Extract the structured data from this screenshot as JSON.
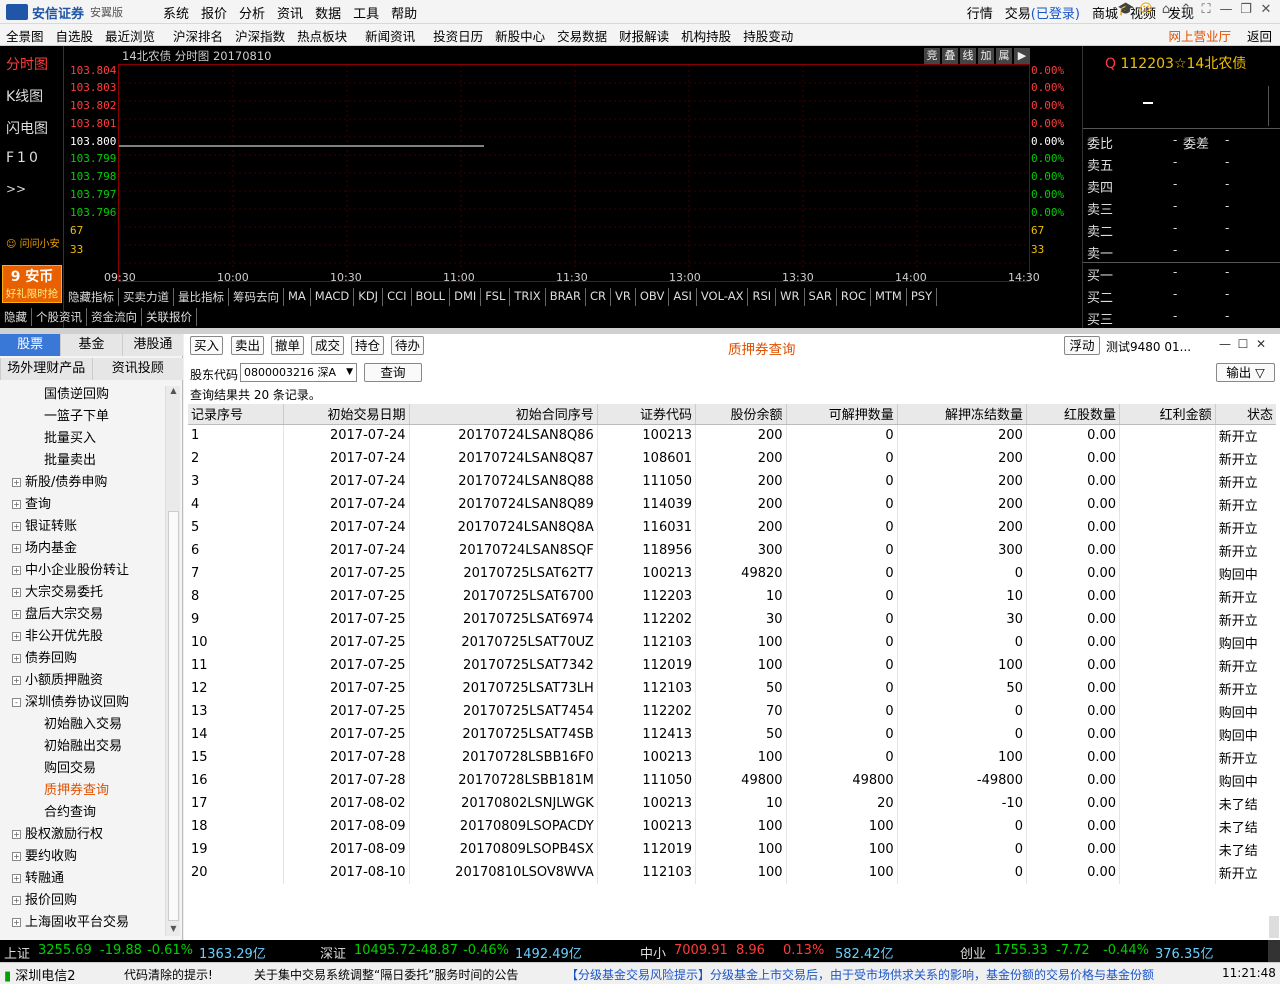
{
  "app": {
    "logo_name": "安信证券",
    "logo_en": "ESSENCE SECURITIES",
    "edition": "安翼版"
  },
  "menu": [
    "系统",
    "报价",
    "分析",
    "资讯",
    "数据",
    "工具",
    "帮助"
  ],
  "right_menu": {
    "quote": "行情",
    "trade": "交易",
    "trade_status": "(已登录)",
    "mall": "商城",
    "video": "视频",
    "discover": "发现"
  },
  "nav": [
    "全景图",
    "自选股",
    "最近浏览",
    "沪深排名",
    "沪深指数",
    "热点板块",
    "新闻资讯",
    "投资日历",
    "新股中心",
    "交易数据",
    "财报解读",
    "机构持股",
    "持股变动"
  ],
  "nav_right": {
    "online": "网上营业厅",
    "back": "返回"
  },
  "chart": {
    "title": "14北农债 分时图 20170810",
    "left_tabs": [
      "分时图",
      "K线图",
      "闪电图",
      "F10",
      ">>"
    ],
    "ask_label": "问问小安",
    "promo_title": "9 安币",
    "promo_sub": "好礼限时抢",
    "tools": [
      "竞",
      "叠",
      "线",
      "加",
      "属",
      "▶"
    ],
    "y_labels": [
      "103.804",
      "103.803",
      "103.802",
      "103.801",
      "103.800",
      "103.799",
      "103.798",
      "103.797",
      "103.796",
      "67",
      "33"
    ],
    "pct_labels": [
      "0.00%",
      "0.00%",
      "0.00%",
      "0.00%",
      "0.00%",
      "0.00%",
      "0.00%",
      "0.00%",
      "0.00%",
      "67",
      "33"
    ],
    "x_labels": [
      "09:30",
      "10:00",
      "10:30",
      "11:00",
      "11:30",
      "13:00",
      "13:30",
      "14:00",
      "14:30",
      "15:00"
    ],
    "indicators": [
      "隐藏指标",
      "买卖力道",
      "量比指标",
      "筹码去向",
      "MA",
      "MACD",
      "KDJ",
      "CCI",
      "BOLL",
      "DMI",
      "FSL",
      "TRIX",
      "BRAR",
      "CR",
      "VR",
      "OBV",
      "ASI",
      "VOL-AX",
      "RSI",
      "WR",
      "SAR",
      "ROC",
      "MTM",
      "PSY"
    ],
    "bottom_tabs": [
      "隐藏",
      "个股资讯",
      "资金流向",
      "关联报价"
    ]
  },
  "chart_data": {
    "type": "line",
    "series": [
      {
        "values": [
          103.8,
          103.8
        ]
      }
    ],
    "x": [
      "09:30",
      "11:00"
    ],
    "ylim": [
      103.796,
      103.804
    ]
  },
  "quote": {
    "code": "112203",
    "star": "☆",
    "name": "14北农债",
    "prefix": "Q",
    "ratio_label": "委比",
    "ratio_val": "-",
    "diff_label": "委差",
    "diff_val": "-",
    "sell": [
      {
        "label": "卖五",
        "p": "-",
        "v": "-"
      },
      {
        "label": "卖四",
        "p": "-",
        "v": "-"
      },
      {
        "label": "卖三",
        "p": "-",
        "v": "-"
      },
      {
        "label": "卖二",
        "p": "-",
        "v": "-"
      },
      {
        "label": "卖一",
        "p": "-",
        "v": "-"
      }
    ],
    "buy": [
      {
        "label": "买一",
        "p": "-",
        "v": "-"
      },
      {
        "label": "买二",
        "p": "-",
        "v": "-"
      },
      {
        "label": "买三",
        "p": "-",
        "v": "-"
      }
    ]
  },
  "sidebar": {
    "tabs1": [
      "股票",
      "基金",
      "港股通"
    ],
    "tabs2": [
      "场外理财产品",
      "资讯投顾"
    ],
    "items": [
      {
        "label": "国债逆回购",
        "level": 2
      },
      {
        "label": "一篮子下单",
        "level": 2
      },
      {
        "label": "批量买入",
        "level": 2
      },
      {
        "label": "批量卖出",
        "level": 2
      },
      {
        "label": "新股/债券申购",
        "level": 1,
        "sym": "+"
      },
      {
        "label": "查询",
        "level": 1,
        "sym": "+"
      },
      {
        "label": "银证转账",
        "level": 1,
        "sym": "+"
      },
      {
        "label": "场内基金",
        "level": 1,
        "sym": "+"
      },
      {
        "label": "中小企业股份转让",
        "level": 1,
        "sym": "+"
      },
      {
        "label": "大宗交易委托",
        "level": 1,
        "sym": "+"
      },
      {
        "label": "盘后大宗交易",
        "level": 1,
        "sym": "+"
      },
      {
        "label": "非公开优先股",
        "level": 1,
        "sym": "+"
      },
      {
        "label": "债券回购",
        "level": 1,
        "sym": "+"
      },
      {
        "label": "小额质押融资",
        "level": 1,
        "sym": "+"
      },
      {
        "label": "深圳债券协议回购",
        "level": 1,
        "sym": "-"
      },
      {
        "label": "初始融入交易",
        "level": 2
      },
      {
        "label": "初始融出交易",
        "level": 2
      },
      {
        "label": "购回交易",
        "level": 2
      },
      {
        "label": "质押券查询",
        "level": 2,
        "active": true
      },
      {
        "label": "合约查询",
        "level": 2
      },
      {
        "label": "股权激励行权",
        "level": 1,
        "sym": "+"
      },
      {
        "label": "要约收购",
        "level": 1,
        "sym": "+"
      },
      {
        "label": "转融通",
        "level": 1,
        "sym": "+"
      },
      {
        "label": "报价回购",
        "level": 1,
        "sym": "+"
      },
      {
        "label": "上海固收平台交易",
        "level": 1,
        "sym": "+"
      }
    ]
  },
  "content": {
    "buttons": [
      "买入",
      "卖出",
      "撤单",
      "成交",
      "持仓",
      "待办"
    ],
    "title": "质押券查询",
    "float_btn": "浮动",
    "account": "测试9480 01...",
    "export_btn": "输出 ▽",
    "holder_label": "股东代码",
    "holder_value": "0800003216 深A",
    "query_btn": "查询",
    "result_text": "查询结果共 20 条记录。",
    "columns": [
      "记录序号",
      "初始交易日期",
      "初始合同序号",
      "证券代码",
      "股份余额",
      "可解押数量",
      "解押冻结数量",
      "红股数量",
      "红利金额",
      "状态"
    ],
    "rows": [
      [
        "1",
        "2017-07-24",
        "20170724LSAN8Q86",
        "100213",
        "200",
        "0",
        "200",
        "0.00",
        "",
        "新开立"
      ],
      [
        "2",
        "2017-07-24",
        "20170724LSAN8Q87",
        "108601",
        "200",
        "0",
        "200",
        "0.00",
        "",
        "新开立"
      ],
      [
        "3",
        "2017-07-24",
        "20170724LSAN8Q88",
        "111050",
        "200",
        "0",
        "200",
        "0.00",
        "",
        "新开立"
      ],
      [
        "4",
        "2017-07-24",
        "20170724LSAN8Q89",
        "114039",
        "200",
        "0",
        "200",
        "0.00",
        "",
        "新开立"
      ],
      [
        "5",
        "2017-07-24",
        "20170724LSAN8Q8A",
        "116031",
        "200",
        "0",
        "200",
        "0.00",
        "",
        "新开立"
      ],
      [
        "6",
        "2017-07-24",
        "20170724LSAN8SQF",
        "118956",
        "300",
        "0",
        "300",
        "0.00",
        "",
        "新开立"
      ],
      [
        "7",
        "2017-07-25",
        "20170725LSAT62T7",
        "100213",
        "49820",
        "0",
        "0",
        "0.00",
        "",
        "购回中"
      ],
      [
        "8",
        "2017-07-25",
        "20170725LSAT6700",
        "112203",
        "10",
        "0",
        "10",
        "0.00",
        "",
        "新开立"
      ],
      [
        "9",
        "2017-07-25",
        "20170725LSAT6974",
        "112202",
        "30",
        "0",
        "30",
        "0.00",
        "",
        "新开立"
      ],
      [
        "10",
        "2017-07-25",
        "20170725LSAT70UZ",
        "112103",
        "100",
        "0",
        "0",
        "0.00",
        "",
        "购回中"
      ],
      [
        "11",
        "2017-07-25",
        "20170725LSAT7342",
        "112019",
        "100",
        "0",
        "100",
        "0.00",
        "",
        "新开立"
      ],
      [
        "12",
        "2017-07-25",
        "20170725LSAT73LH",
        "112103",
        "50",
        "0",
        "50",
        "0.00",
        "",
        "新开立"
      ],
      [
        "13",
        "2017-07-25",
        "20170725LSAT7454",
        "112202",
        "70",
        "0",
        "0",
        "0.00",
        "",
        "购回中"
      ],
      [
        "14",
        "2017-07-25",
        "20170725LSAT74SB",
        "112413",
        "50",
        "0",
        "0",
        "0.00",
        "",
        "购回中"
      ],
      [
        "15",
        "2017-07-28",
        "20170728LSBB16F0",
        "100213",
        "100",
        "0",
        "100",
        "0.00",
        "",
        "新开立"
      ],
      [
        "16",
        "2017-07-28",
        "20170728LSBB181M",
        "111050",
        "49800",
        "49800",
        "-49800",
        "0.00",
        "",
        "购回中"
      ],
      [
        "17",
        "2017-08-02",
        "20170802LSNJLWGK",
        "100213",
        "10",
        "20",
        "-10",
        "0.00",
        "",
        "未了结"
      ],
      [
        "18",
        "2017-08-09",
        "20170809LSOPACDY",
        "100213",
        "100",
        "100",
        "0",
        "0.00",
        "",
        "未了结"
      ],
      [
        "19",
        "2017-08-09",
        "20170809LSOPB4SX",
        "112019",
        "100",
        "100",
        "0",
        "0.00",
        "",
        "未了结"
      ],
      [
        "20",
        "2017-08-10",
        "20170810LSOV8WVA",
        "112103",
        "100",
        "100",
        "0",
        "0.00",
        "",
        "新开立"
      ]
    ]
  },
  "status": [
    {
      "name": "上证",
      "price": "3255.69",
      "chg": "-19.88",
      "pct": "-0.61%",
      "amt": "1363.29亿",
      "up": false
    },
    {
      "name": "深证",
      "price": "10495.72",
      "chg": "-48.87",
      "pct": "-0.46%",
      "amt": "1492.49亿",
      "up": false
    },
    {
      "name": "中小",
      "price": "7009.91",
      "chg": "8.96",
      "pct": "0.13%",
      "amt": "582.42亿",
      "up": true
    },
    {
      "name": "创业",
      "price": "1755.33",
      "chg": "-7.72",
      "pct": "-0.44%",
      "amt": "376.35亿",
      "up": false
    }
  ],
  "ticker": {
    "signal": "深圳电信2",
    "msg1": "代码清除的提示!",
    "msg2": "关于集中交易系统调整“隔日委托”服务时间的公告",
    "msg3": "【分级基金交易风险提示】分级基金上市交易后，由于受市场供求关系的影响，基金份额的交易价格与基金份额",
    "time": "11:21:48"
  },
  "colors": {
    "up": "#ff3c3c",
    "down": "#00d000",
    "accent": "#1a55c8",
    "active": "#e05000",
    "sidebar_active_tab": "#3a78d8"
  }
}
